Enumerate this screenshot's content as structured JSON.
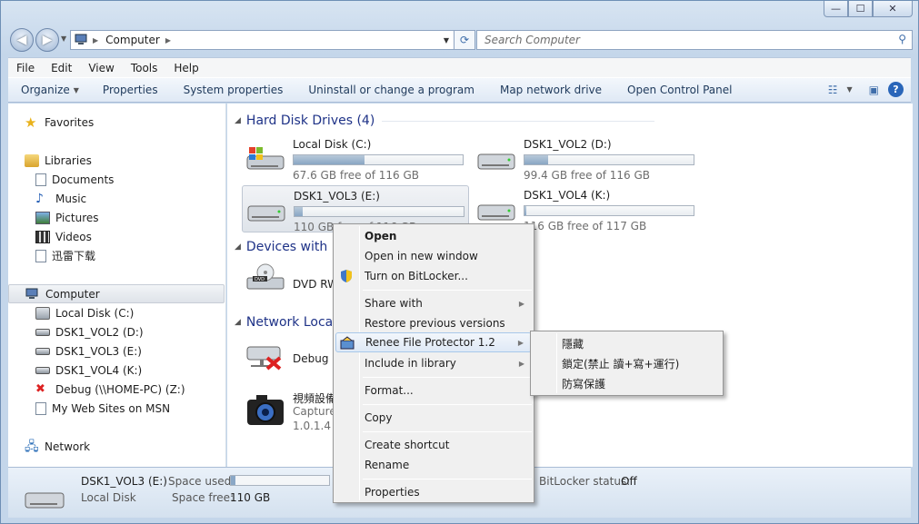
{
  "window": {
    "caption_min": "—",
    "caption_max": "☐",
    "caption_close": "✕"
  },
  "address": {
    "back_icon": "back-arrow-icon",
    "forward_icon": "forward-arrow-icon",
    "location": "Computer",
    "search_placeholder": "Search Computer"
  },
  "menubar": [
    "File",
    "Edit",
    "View",
    "Tools",
    "Help"
  ],
  "commandbar": {
    "items": [
      "Organize",
      "Properties",
      "System properties",
      "Uninstall or change a program",
      "Map network drive",
      "Open Control Panel"
    ]
  },
  "nav": {
    "favorites": "Favorites",
    "libraries": "Libraries",
    "documents": "Documents",
    "music": "Music",
    "pictures": "Pictures",
    "videos": "Videos",
    "xunlei": "迅雷下载",
    "computer": "Computer",
    "local_disk": "Local Disk (C:)",
    "vol2": "DSK1_VOL2 (D:)",
    "vol3": "DSK1_VOL3 (E:)",
    "vol4": "DSK1_VOL4 (K:)",
    "debug": "Debug (\\\\HOME-PC) (Z:)",
    "websites": "My Web Sites on MSN",
    "network": "Network"
  },
  "content": {
    "hdd_header": "Hard Disk Drives (4)",
    "devices_header": "Devices with R",
    "network_header": "Network Locat",
    "drives": [
      {
        "name": "Local Disk (C:)",
        "free": "67.6 GB free of 116 GB",
        "used_fraction": 0.42
      },
      {
        "name": "DSK1_VOL2 (D:)",
        "free": "99.4 GB free of 116 GB",
        "used_fraction": 0.14
      },
      {
        "name": "DSK1_VOL3 (E:)",
        "free": "110 GB free of 116 GB",
        "used_fraction": 0.05
      },
      {
        "name": "DSK1_VOL4 (K:)",
        "free": "116 GB free of 117 GB",
        "used_fraction": 0.01
      }
    ],
    "dvd": "DVD RW",
    "debug": "Debug (\\",
    "video_name": "視頻設備",
    "video_sub1": "Capture",
    "video_sub2": "1.0.1.4"
  },
  "status": {
    "name": "DSK1_VOL3 (E:)",
    "type": "Local Disk",
    "space_used_label": "Space used:",
    "space_free_label": "Space free:",
    "space_free_value": "110 GB",
    "bitlocker_label": "BitLocker status:",
    "bitlocker_value": "Off"
  },
  "context_menu": {
    "open": "Open",
    "open_new": "Open in new window",
    "bitlocker": "Turn on BitLocker...",
    "share": "Share with",
    "restore": "Restore previous versions",
    "renee": "Renee File Protector 1.2",
    "include": "Include in library",
    "format": "Format...",
    "copy": "Copy",
    "shortcut": "Create shortcut",
    "rename": "Rename",
    "properties": "Properties"
  },
  "submenu": {
    "hide": "隱藏",
    "lock": "鎖定(禁止 讀+寫+運行)",
    "protect": "防寫保護"
  }
}
